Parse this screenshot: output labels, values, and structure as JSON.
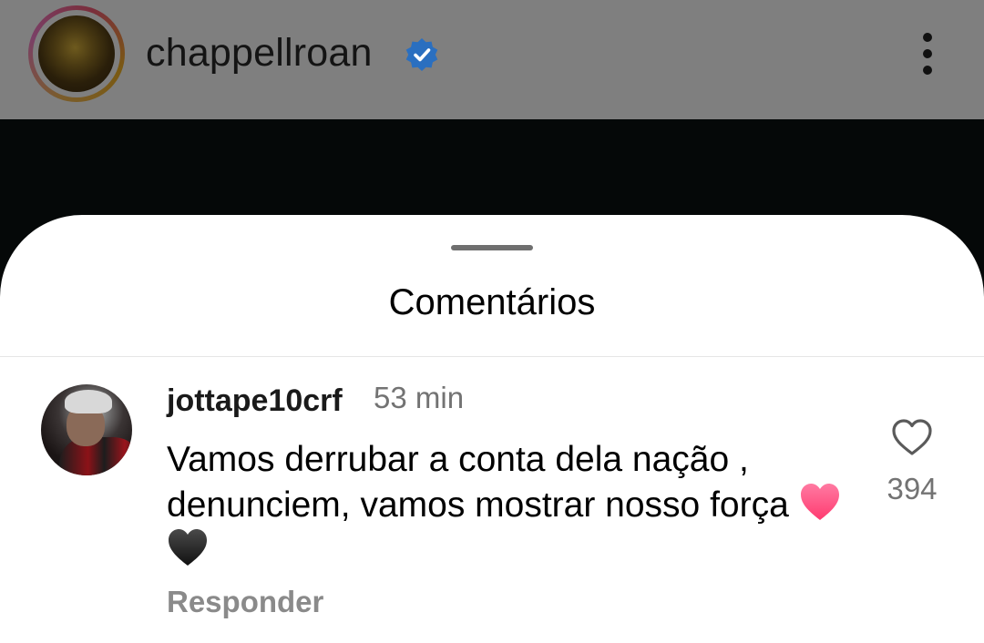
{
  "header": {
    "username": "chappellroan",
    "verified_icon": "verified-badge-icon",
    "more_icon": "more-vertical-icon"
  },
  "sheet": {
    "title": "Comentários"
  },
  "comment": {
    "username": "jottape10crf",
    "time": "53 min",
    "text": "Vamos derrubar a conta dela nação , denunciem, vamos mostrar nosso força",
    "emojis": [
      "pink-heart",
      "black-heart"
    ],
    "reply_label": "Responder",
    "like_count": "394"
  },
  "colors": {
    "verified_blue": "#2a6fc0",
    "heart_pink": "#ff4f8b",
    "muted_text": "#737373"
  }
}
